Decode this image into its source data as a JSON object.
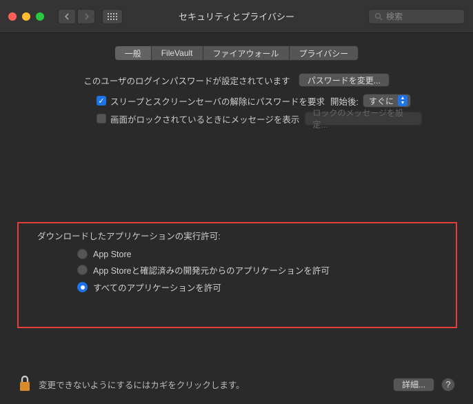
{
  "window": {
    "title": "セキュリティとプライバシー"
  },
  "search": {
    "placeholder": "検索"
  },
  "tabs": {
    "general": "一般",
    "filevault": "FileVault",
    "firewall": "ファイアウォール",
    "privacy": "プライバシー"
  },
  "general": {
    "password_set_msg": "このユーザのログインパスワードが設定されています",
    "change_password_btn": "パスワードを変更...",
    "require_password_label": "スリープとスクリーンセーバの解除にパスワードを要求",
    "after_label": "開始後:",
    "delay_value": "すぐに",
    "show_message_label": "画面がロックされているときにメッセージを表示",
    "lock_message_placeholder": "ロックのメッセージを設定..."
  },
  "apps": {
    "section_label": "ダウンロードしたアプリケーションの実行許可:",
    "options": {
      "appstore": "App Store",
      "identified": "App Storeと確認済みの開発元からのアプリケーションを許可",
      "anywhere": "すべてのアプリケーションを許可"
    },
    "selected": "anywhere"
  },
  "footer": {
    "lock_hint": "変更できないようにするにはカギをクリックします。",
    "details_btn": "詳細..."
  }
}
